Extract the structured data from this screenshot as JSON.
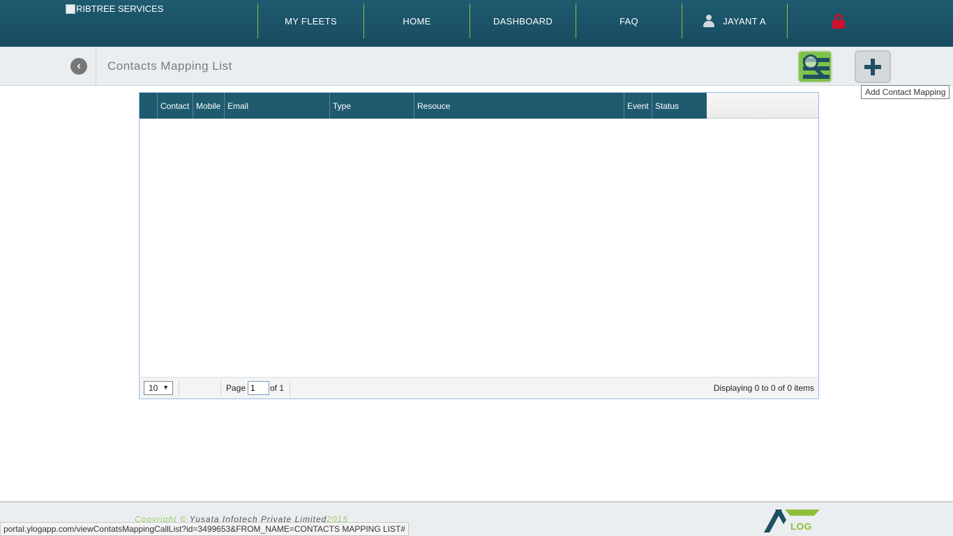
{
  "header": {
    "logo_alt": "RIBTREE SERVICES",
    "nav": [
      {
        "label": "MY FLEETS"
      },
      {
        "label": "HOME"
      },
      {
        "label": "DASHBOARD"
      },
      {
        "label": "FAQ"
      },
      {
        "label": "JAYANT A",
        "icon": "user-icon"
      }
    ],
    "logout_icon": "lock-icon",
    "logout_color": "#d0112b"
  },
  "subheader": {
    "title": "Contacts Mapping List",
    "back_icon": "chevron-left-icon",
    "search_icon": "search-list-icon",
    "add_icon": "plus-icon",
    "add_tooltip": "Add Contact Mapping"
  },
  "grid": {
    "columns": [
      "",
      "Contact",
      "Mobile",
      "Email",
      "Type",
      "Resouce",
      "Event",
      "Status"
    ],
    "rows": [],
    "pager": {
      "page_size": "10",
      "page_label": "Page",
      "page_value": "1",
      "of_label": "of 1",
      "display_text": "Displaying 0 to 0 of 0 items"
    }
  },
  "footer": {
    "copyright_prefix": "Copyright ©",
    "company": "Yusata Infotech Private Limited",
    "year": "2015",
    "logo_text": "LOG"
  },
  "status_url": "portal.ylogapp.com/viewContatsMappingCallList?id=3499653&FROM_NAME=CONTACTS MAPPING LIST#",
  "colors": {
    "primary": "#1f5a6f",
    "accent": "#8fbf3a",
    "search_bg": "#7fc24a"
  }
}
